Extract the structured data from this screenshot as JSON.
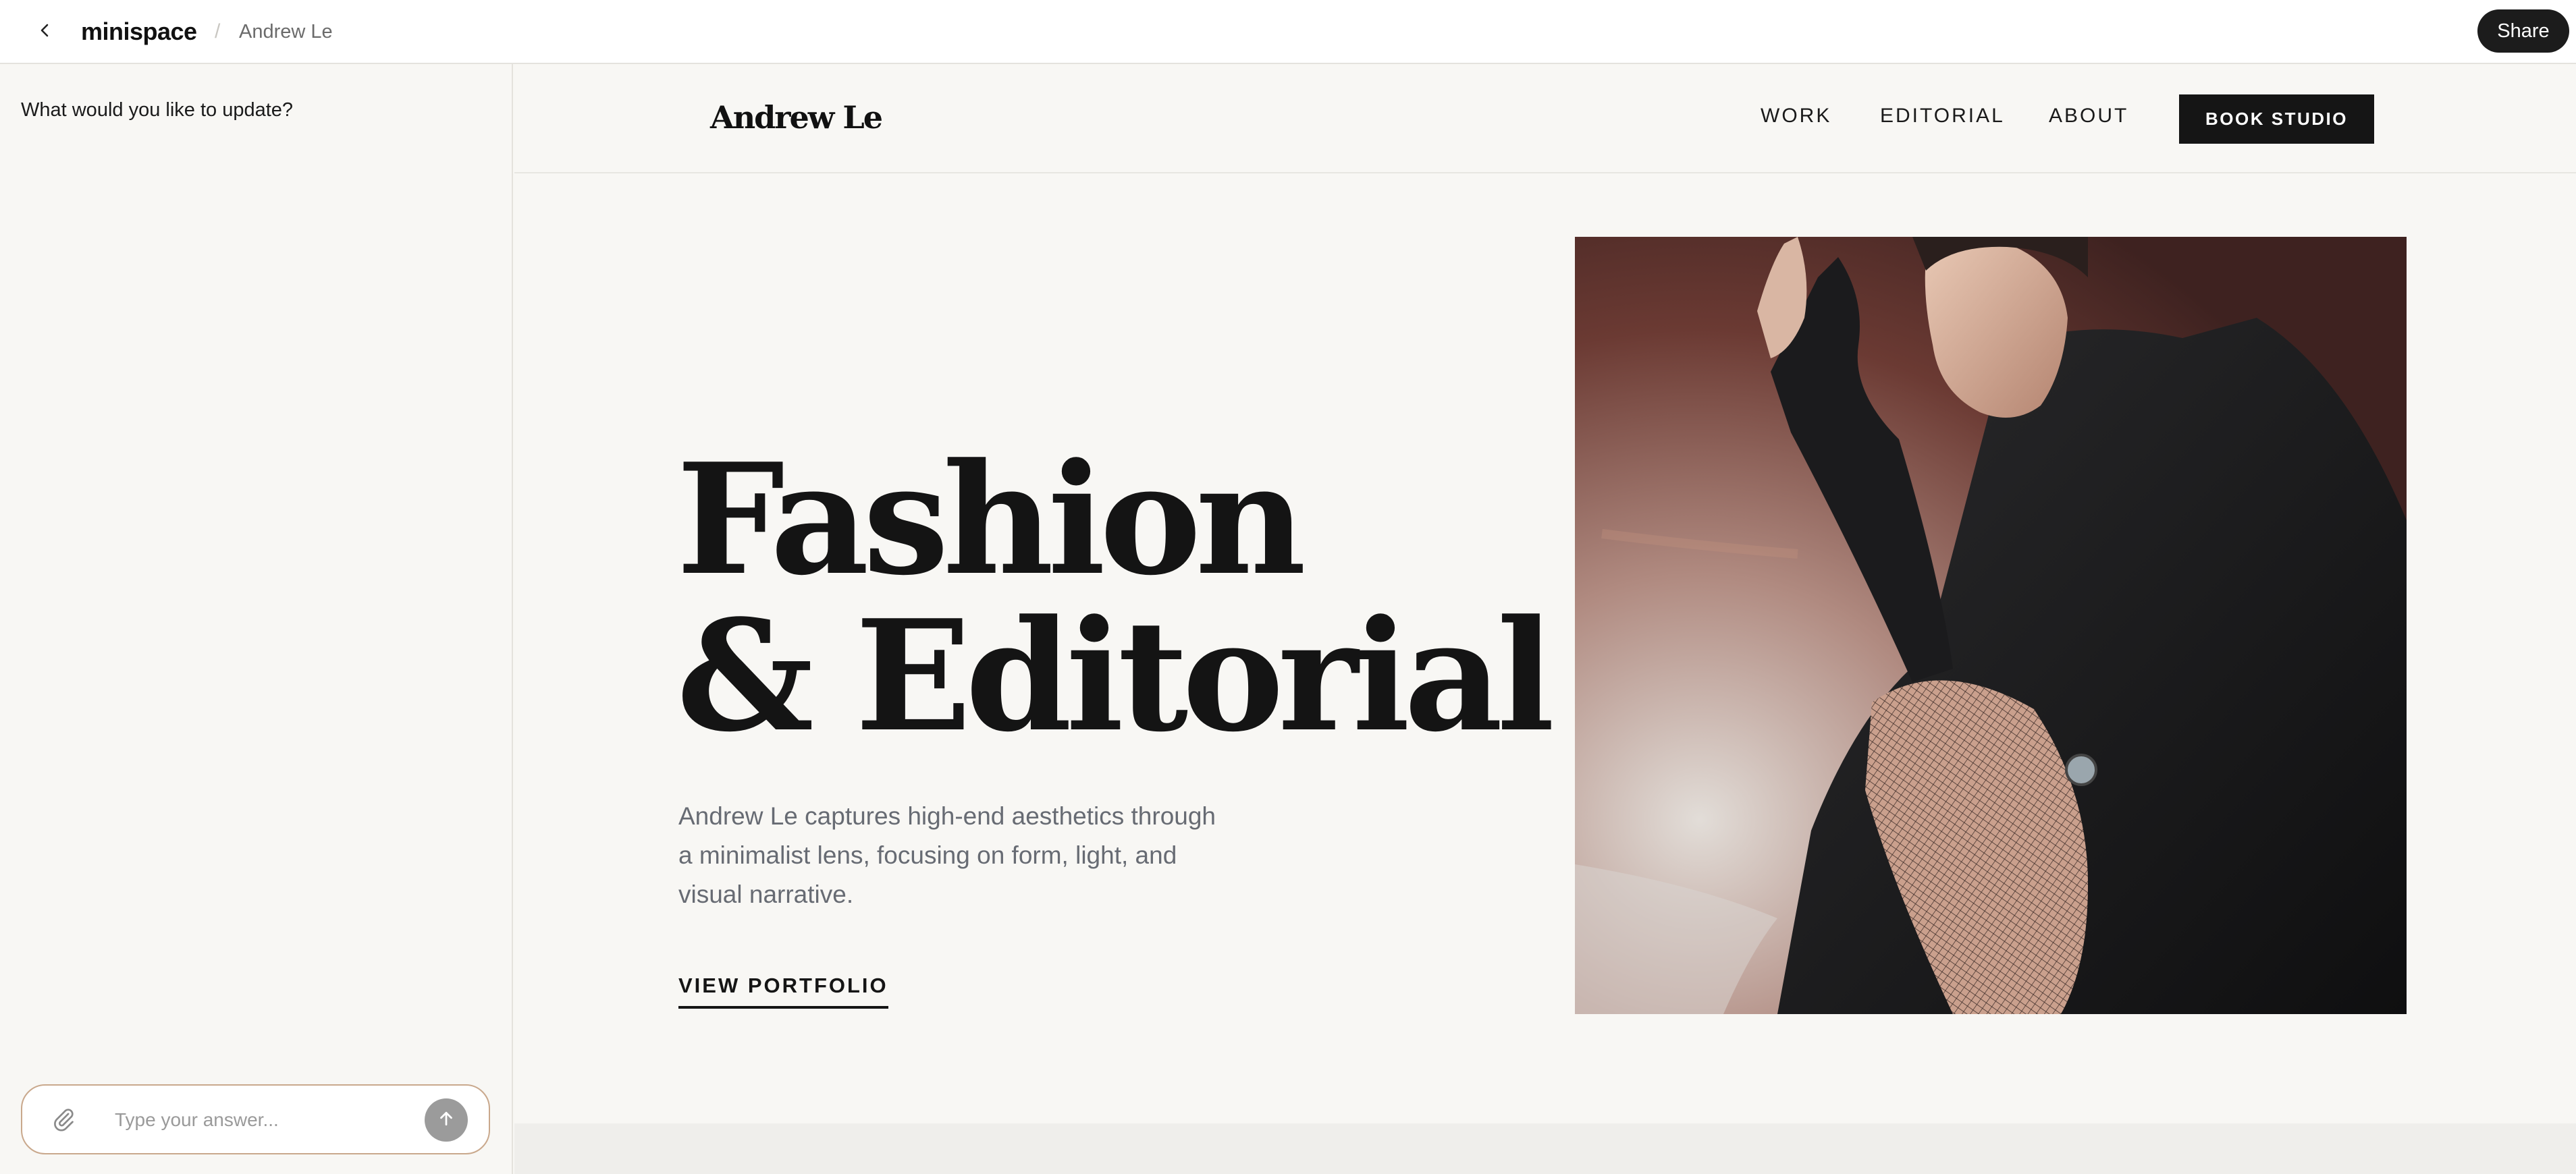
{
  "topbar": {
    "brand": "minispace",
    "separator": "/",
    "breadcrumb": "Andrew Le",
    "share_label": "Share"
  },
  "chat": {
    "prompt": "What would you like to update?",
    "input_placeholder": "Type your answer...",
    "input_value": ""
  },
  "site": {
    "logo": "Andrew Le",
    "nav": [
      "WORK",
      "EDITORIAL",
      "ABOUT"
    ],
    "cta": "BOOK STUDIO",
    "hero": {
      "title_line1": "Fashion",
      "title_line2": "& Editorial",
      "description": "Andrew Le captures high-end aesthetics through a minimalist lens, focusing on form, light, and visual narrative.",
      "link_label": "VIEW PORTFOLIO"
    }
  },
  "icons": {
    "back": "chevron-left-icon",
    "attach": "paperclip-icon",
    "send": "arrow-up-icon"
  },
  "colors": {
    "page_bg": "#f8f7f4",
    "dark": "#151515",
    "input_border": "#c9a88c",
    "muted_text": "#676b73",
    "send_button": "#9b9b9b"
  }
}
